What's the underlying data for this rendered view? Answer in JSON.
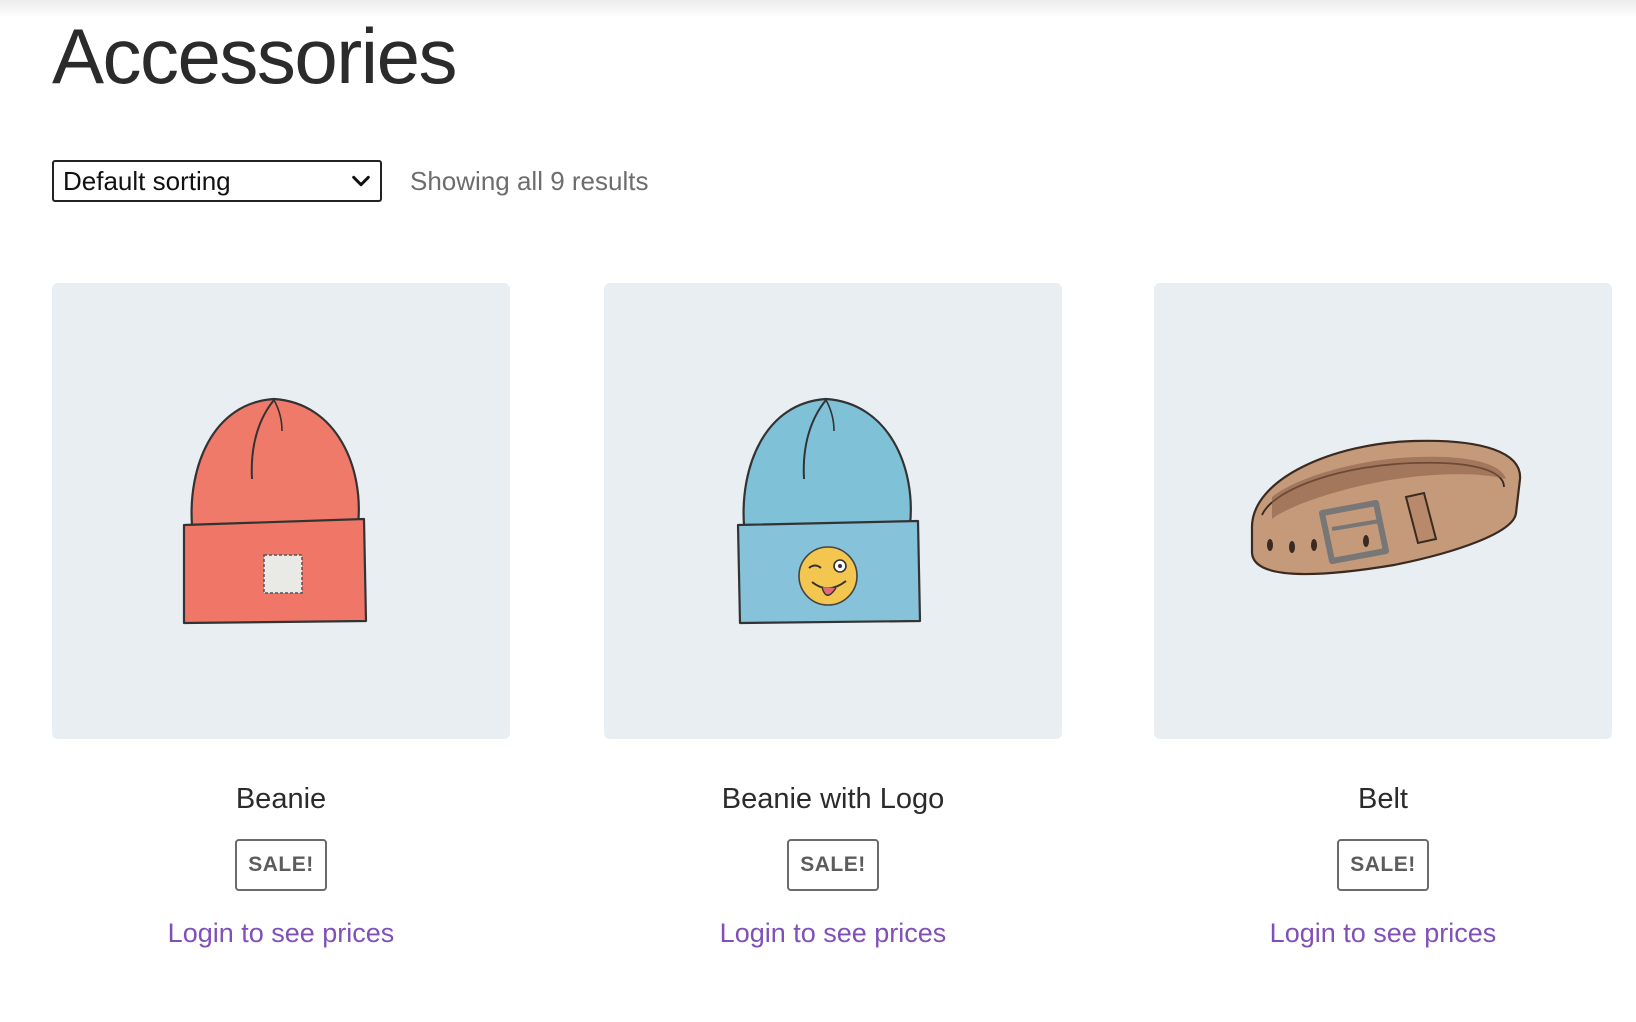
{
  "page": {
    "title": "Accessories"
  },
  "toolbar": {
    "sort_selected": "Default sorting",
    "result_count": "Showing all 9 results"
  },
  "products": [
    {
      "name": "Beanie",
      "badge": "SALE!",
      "price_link": "Login to see prices",
      "icon": "beanie-red-icon"
    },
    {
      "name": "Beanie with Logo",
      "badge": "SALE!",
      "price_link": "Login to see prices",
      "icon": "beanie-blue-logo-icon"
    },
    {
      "name": "Belt",
      "badge": "SALE!",
      "price_link": "Login to see prices",
      "icon": "belt-icon"
    }
  ],
  "colors": {
    "image_bg": "#e9eef2",
    "link": "#8050b8",
    "badge_border": "#6b6b6b"
  }
}
